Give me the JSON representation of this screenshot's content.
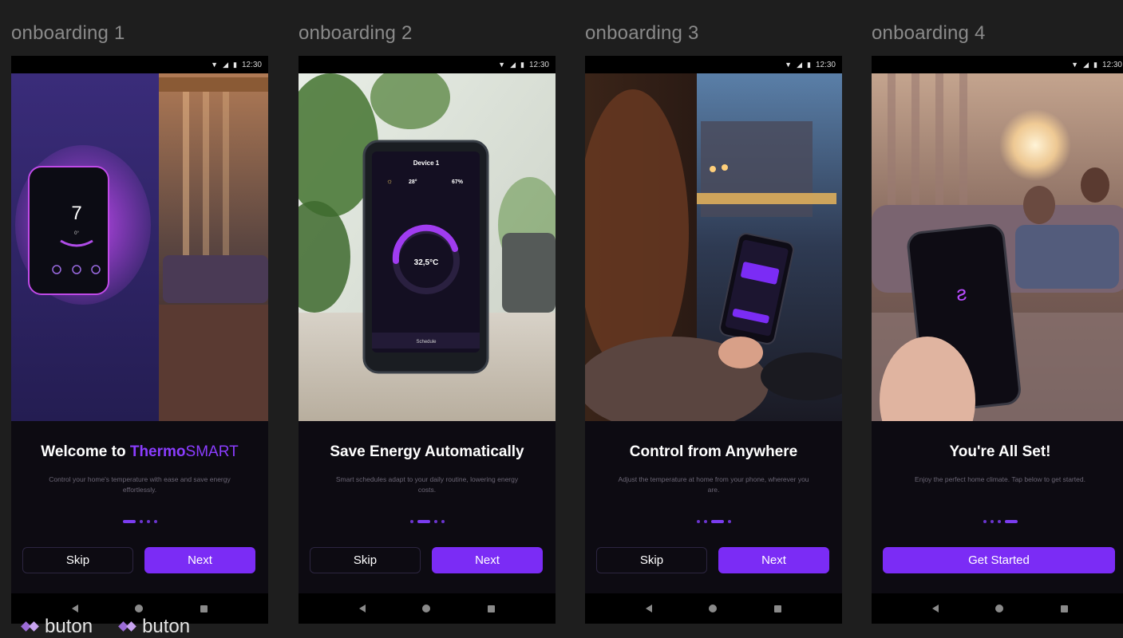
{
  "colors": {
    "accent": "#7b2cf5",
    "background": "#1e1e1e",
    "screen_bg": "#0d0b12"
  },
  "status_bar": {
    "time": "12:30",
    "icons": [
      "wifi-icon",
      "signal-icon",
      "battery-icon"
    ]
  },
  "nav_bar": {
    "icons": [
      "back-icon",
      "home-icon",
      "recents-icon"
    ]
  },
  "screens": [
    {
      "label": "onboarding 1",
      "title_prefix": "Welcome to",
      "title_accent": "Thermo",
      "title_suffix": "SMART",
      "subtitle": "Control your home's temperature with ease and save energy effortlessly.",
      "active_dot": 0,
      "skip_label": "Skip",
      "next_label": "Next",
      "thermostat": {
        "temp": "7",
        "sub": "0°"
      }
    },
    {
      "label": "onboarding 2",
      "title": "Save Energy Automatically",
      "subtitle": "Smart schedules adapt to your daily routine, lowering energy costs.",
      "active_dot": 1,
      "skip_label": "Skip",
      "next_label": "Next",
      "device": {
        "name": "Device 1",
        "weather_temp": "28°",
        "humidity": "67%",
        "setpoint": "32,5°C",
        "tab": "Schedule"
      }
    },
    {
      "label": "onboarding 3",
      "title": "Control from Anywhere",
      "subtitle": "Adjust the temperature at home from your phone, wherever you are.",
      "active_dot": 2,
      "skip_label": "Skip",
      "next_label": "Next"
    },
    {
      "label": "onboarding 4",
      "title": "You're All Set!",
      "subtitle": "Enjoy the perfect home climate. Tap below to get started.",
      "active_dot": 3,
      "cta_label": "Get Started"
    }
  ],
  "footer": {
    "buton_1": "buton",
    "buton_2": "buton"
  }
}
